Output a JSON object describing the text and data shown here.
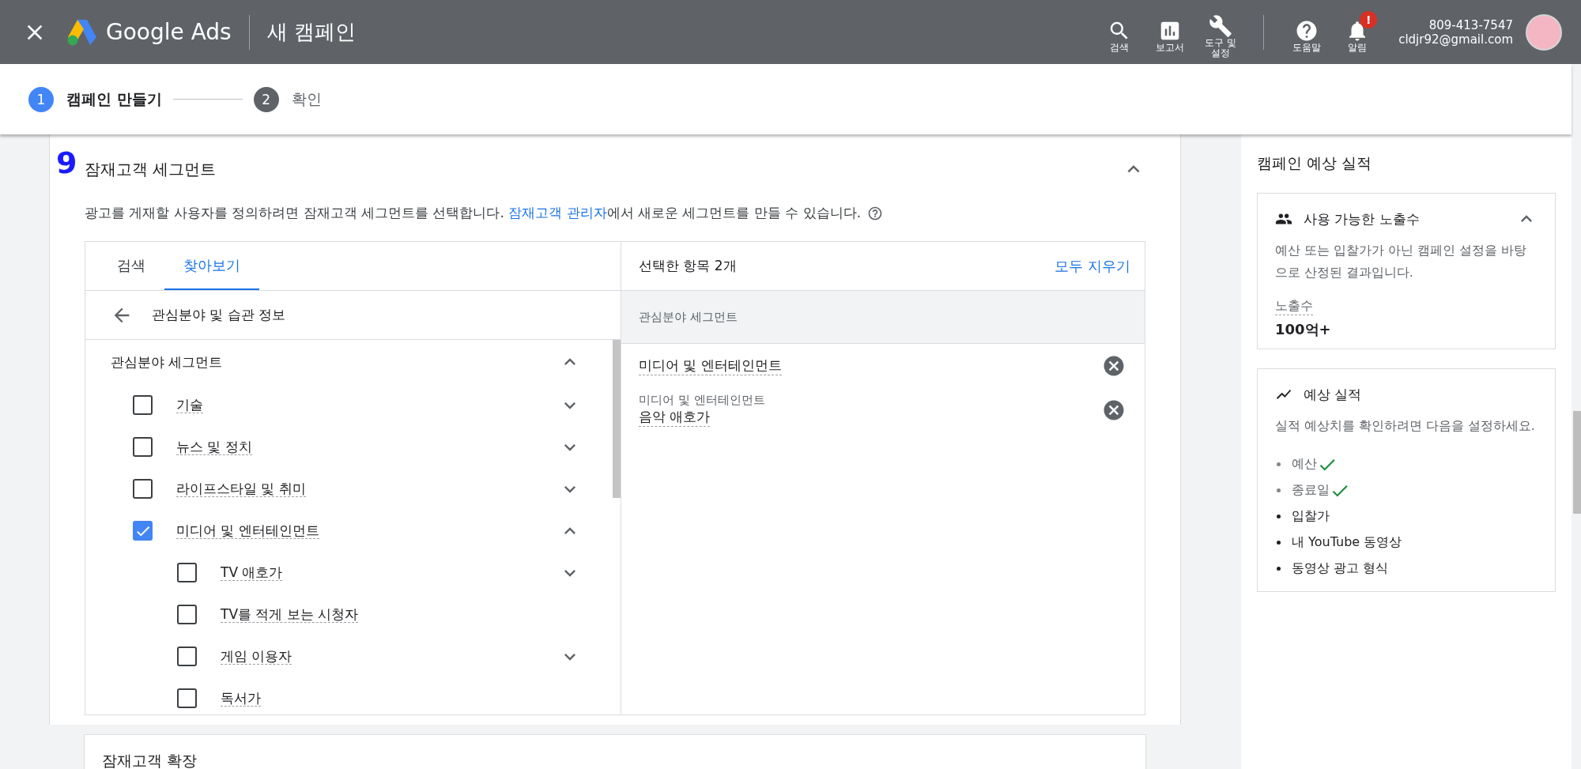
{
  "header": {
    "logo_text": "Google Ads",
    "page_title": "새 캠페인",
    "nav": [
      {
        "kind": "search",
        "label": "검색"
      },
      {
        "kind": "reports",
        "label": "보고서"
      },
      {
        "kind": "tools",
        "label": "도구 및 설정"
      },
      {
        "kind": "help",
        "label": "도움말"
      },
      {
        "kind": "notifications",
        "label": "알림",
        "badge": "!"
      }
    ],
    "phone": "809-413-7547",
    "email": "cldjr92@gmail.com"
  },
  "stepper": {
    "steps": [
      {
        "number": "1",
        "label": "캠페인 만들기",
        "selected": true
      },
      {
        "number": "2",
        "label": "확인",
        "selected": false
      }
    ]
  },
  "section": {
    "number": "9",
    "title": "잠재고객 세그먼트",
    "expanded": true,
    "description": {
      "before": "광고를 게재할 사용자를 정의하려면 잠재고객 세그먼트를 선택합니다. ",
      "link": "잠재고객 관리자",
      "after": "에서 새로운 세그먼트를 만들 수 있습니다."
    },
    "tabs": [
      {
        "label": "검색",
        "selected": false
      },
      {
        "label": "찾아보기",
        "selected": true
      }
    ],
    "back_label": "관심분야 및 습관 정보",
    "list": {
      "heading": "관심분야 세그먼트",
      "expanded": true,
      "items": [
        {
          "label": "기술",
          "checked": false,
          "expanded": false
        },
        {
          "label": "뉴스 및 정치",
          "checked": false,
          "expanded": false
        },
        {
          "label": "라이프스타일 및 취미",
          "checked": false,
          "expanded": false
        },
        {
          "label": "미디어 및 엔터테인먼트",
          "checked": true,
          "expanded": true,
          "children": [
            {
              "label": "TV 애호가",
              "checked": false,
              "expanded": false
            },
            {
              "label": "TV를 적게 보는 시청자",
              "checked": false
            },
            {
              "label": "게임 이용자",
              "checked": false,
              "expanded": false
            },
            {
              "label": "독서가",
              "checked": false
            }
          ]
        }
      ]
    },
    "selected_panel": {
      "count_label": "선택한 항목 2개",
      "clear_all": "모두 지우기",
      "group_label": "관심분야 세그먼트",
      "items": [
        {
          "label": "미디어 및 엔터테인먼트"
        },
        {
          "parent": "미디어 및 엔터테인먼트",
          "label": "음악 애호가"
        }
      ]
    }
  },
  "expansion": {
    "title": "잠재고객 확장"
  },
  "sidebar": {
    "title": "캠페인 예상 실적",
    "impressions": {
      "title": "사용 가능한 노출수",
      "expanded": true,
      "description": "예산 또는 입찰가가 아닌 캠페인 설정을 바탕으로 산정된 결과입니다.",
      "metric_label": "노출수",
      "metric_value": "100억+"
    },
    "forecast": {
      "title": "예상 실적",
      "description": "실적 예상치를 확인하려면 다음을 설정하세요.",
      "requirements": [
        {
          "label": "예산",
          "done": true
        },
        {
          "label": "종료일",
          "done": true
        },
        {
          "label": "입찰가",
          "done": false
        },
        {
          "label": "내 YouTube 동영상",
          "done": false
        },
        {
          "label": "동영상 광고 형식",
          "done": false
        }
      ]
    }
  }
}
